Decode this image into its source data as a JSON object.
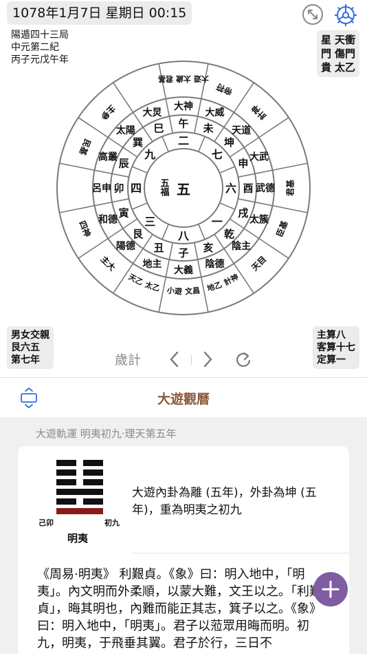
{
  "header": {
    "datetime": "1078年1月7日 星期日 00:15"
  },
  "info_top_left": {
    "line1": "陽遁四十三局",
    "line2": "中元第二紀",
    "line3": "丙子元戊午年"
  },
  "info_top_right": {
    "col1_line1": "星",
    "col1_line2": "門",
    "col1_line3": "貴",
    "col2_line1": "天衝",
    "col2_line2": "傷門",
    "col2_line3": "太乙"
  },
  "info_bottom_left": {
    "line1": "男女交親",
    "line2": "艮六五",
    "line3": "第七年"
  },
  "info_bottom_right": {
    "line1": "主算八",
    "line2": "客算十七",
    "line3": "定算一"
  },
  "chart": {
    "center": "五",
    "center_left": "五福",
    "inner_ring": [
      "一",
      "八",
      "三",
      "四",
      "九",
      "二",
      "七",
      "六"
    ],
    "branch_ring": [
      "子",
      "丑",
      "艮",
      "寅",
      "卯",
      "辰",
      "巽",
      "巳",
      "午",
      "未",
      "坤",
      "申",
      "酉",
      "戌",
      "乾",
      "亥"
    ],
    "deity_ring": [
      "大義",
      "地主",
      "陽德",
      "和德",
      "呂申",
      "高叢",
      "太陽",
      "大炅",
      "大神",
      "大威",
      "天道",
      "大武",
      "武德",
      "太簇",
      "陰主",
      "陰德"
    ],
    "outer_ring": [
      "文昌 小遊",
      "太乙 天乙",
      "主大",
      "四神",
      "",
      "民基",
      "主參",
      "",
      "",
      "帝符",
      "計神",
      "",
      "君基",
      "臣基",
      "天目",
      "計神 地乙"
    ],
    "outer_ring_top": "大遊 太歲 君基",
    "outer_ring_b1": "主大"
  },
  "controls": {
    "method_label": "歲計"
  },
  "section_header": {
    "title": "大遊觀曆"
  },
  "content": {
    "section_label": "大遊軌運  明夷初九·理天第五年",
    "hex_left_label": "己卯",
    "hex_right_label": "初九",
    "hex_name": "明夷",
    "summary": "大遊內卦為離 (五年)，外卦為坤 (五年)，重為明夷之初九",
    "body": "《周易·明夷》 利艱貞。《象》曰：明入地中，「明夷」。內文明而外柔順，以蒙大難，文王以之。「利艱貞」，晦其明也，內難而能正其志，箕子以之。《象》曰：明入地中，「明夷」。君子以蒞眾用晦而明。初九，明夷，于飛垂其翼。君子於行，三日不"
  },
  "colors": {
    "accent_brown": "#8b5a3c",
    "fab_purple": "#7e5da0",
    "yang_red": "#8b1a1a",
    "gear_blue": "#2a6fdb"
  }
}
